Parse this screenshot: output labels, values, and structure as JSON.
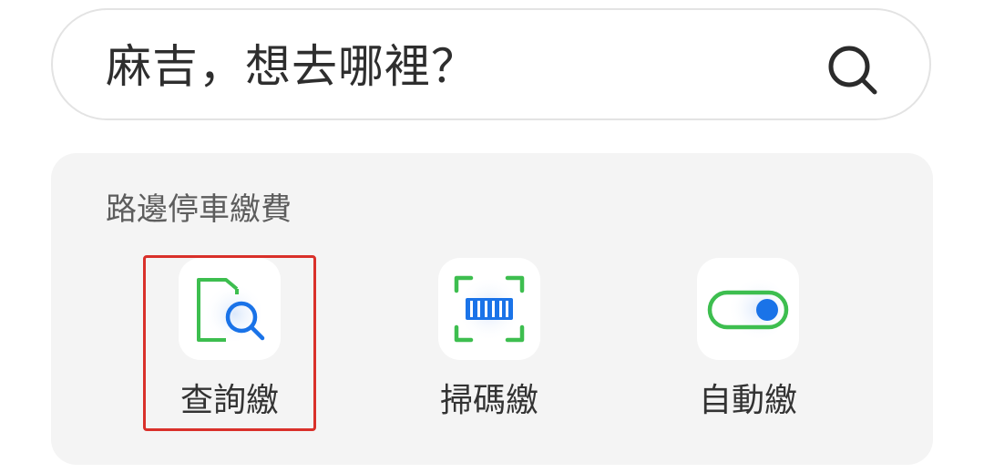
{
  "search": {
    "placeholder": "麻吉，想去哪裡？",
    "icon": "search-icon"
  },
  "parking": {
    "title": "路邊停車繳費",
    "actions": [
      {
        "label": "查詢繳",
        "icon": "document-search-icon",
        "highlighted": true
      },
      {
        "label": "掃碼繳",
        "icon": "barcode-scan-icon",
        "highlighted": false
      },
      {
        "label": "自動繳",
        "icon": "toggle-on-icon",
        "highlighted": false
      }
    ]
  },
  "colors": {
    "green": "#3dbe4f",
    "blue": "#1a73e8",
    "highlight": "#d9302a",
    "panel_background": "#f4f4f4"
  }
}
